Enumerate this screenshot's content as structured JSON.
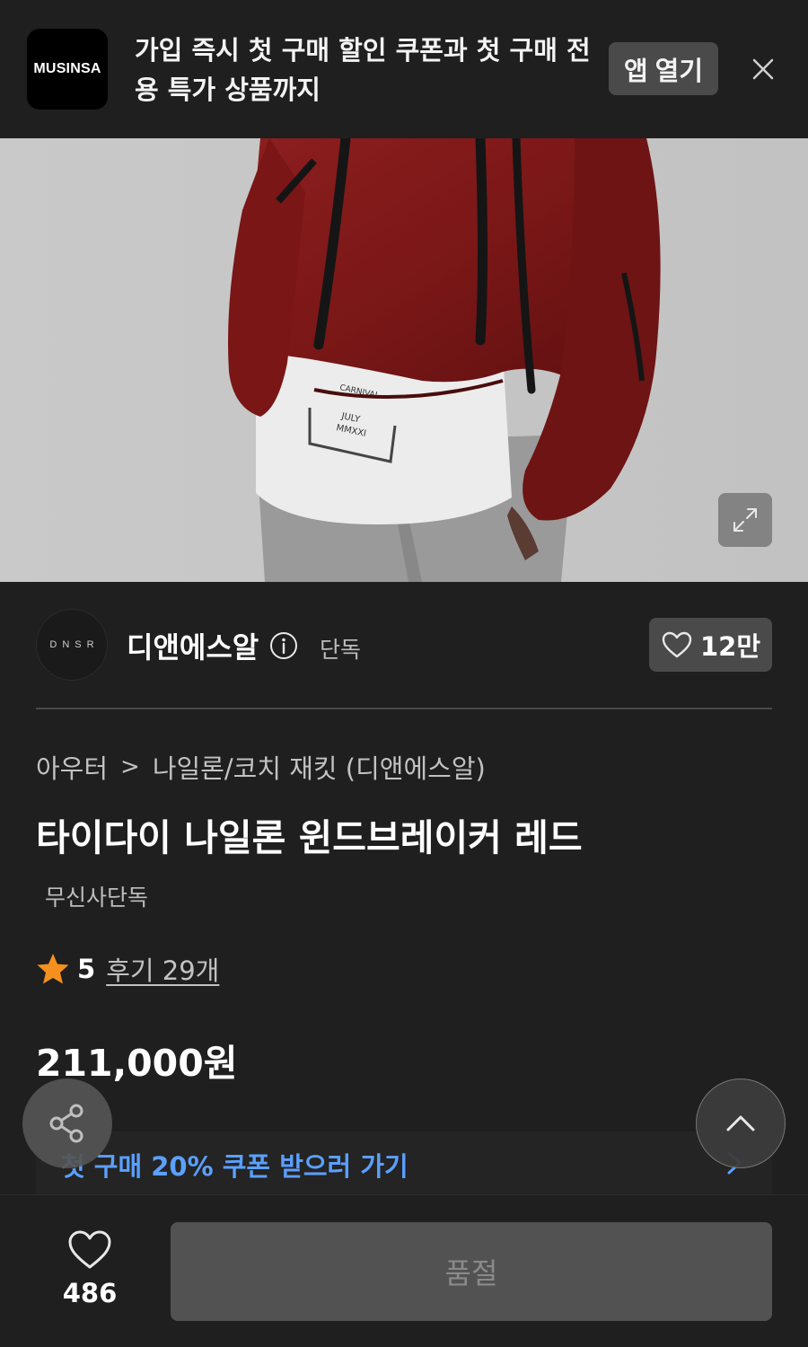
{
  "banner": {
    "app_logo_text": "MUSINSA",
    "message": "가입 즉시 첫 구매 할인 쿠폰과 첫 구매 전용 특가 상품까지",
    "open_app_label": "앱 열기",
    "close_icon": "close-icon"
  },
  "product_image": {
    "expand_icon": "expand-icon",
    "shirt_print": [
      "CARNIVAL",
      "JULY",
      "MMXXI"
    ]
  },
  "brand": {
    "logo_text": "DNSR",
    "name": "디앤에스알",
    "info_icon": "info-icon",
    "tag": "단독",
    "like_count": "12만"
  },
  "breadcrumb": {
    "category": "아우터",
    "separator": ">",
    "subcategory": "나일론/코치 재킷 (디앤에스알)"
  },
  "product": {
    "title": "타이다이 나일론 윈드브레이커 레드",
    "exclusive_label": "무신사단독",
    "rating": "5",
    "review_label": "후기 29개",
    "price": "211,000원"
  },
  "coupon": {
    "label": "첫 구매 20% 쿠폰 받으러 가기",
    "arrow_icon": "chevron-right-icon"
  },
  "floating": {
    "share_icon": "share-icon",
    "top_icon": "chevron-up-icon"
  },
  "bottom_bar": {
    "wish_count": "486",
    "soldout_label": "품절"
  },
  "colors": {
    "background": "#1f1f1f",
    "accent_blue": "#5ba0ff",
    "star_orange": "#f5901e",
    "button_gray": "#4a4a4a"
  }
}
